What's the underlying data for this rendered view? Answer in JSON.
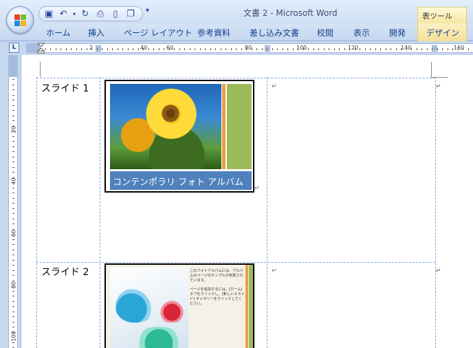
{
  "titlebar": {
    "title": "文書 2 - Microsoft Word",
    "context_group": "表ツール",
    "qat": [
      "save-icon",
      "undo-icon",
      "redo-icon",
      "print-preview-icon",
      "new-document-icon",
      "copy-icon"
    ]
  },
  "ribbon": {
    "tabs": [
      "ホーム",
      "挿入",
      "ページ レイアウト",
      "参考資料",
      "差し込み文書",
      "校閲",
      "表示",
      "開発",
      "デザイン"
    ]
  },
  "ruler": {
    "h_labels": [
      "2",
      "40",
      "60",
      "80",
      "100",
      "120",
      "140",
      "160"
    ],
    "v_labels": [
      "20",
      "40",
      "60",
      "80",
      "100"
    ]
  },
  "document": {
    "rows": [
      {
        "label": "スライド 1",
        "slide_caption": "コンテンポラリ フォト アルバム"
      },
      {
        "label": "スライド 2",
        "slide_text": [
          "このフォトアルバムには、アルバムのページのサンプルが用意されています。",
          "ページを追加するには、[ホーム] タブをクリックし、[新しいスライド] ギャラリーをクリックしてください。"
        ]
      }
    ]
  },
  "colors": {
    "accent_blue": "#4f81bd",
    "accent_green": "#9bbb59",
    "accent_orange": "#f09b4a",
    "table_border": "#7ea6d6"
  }
}
